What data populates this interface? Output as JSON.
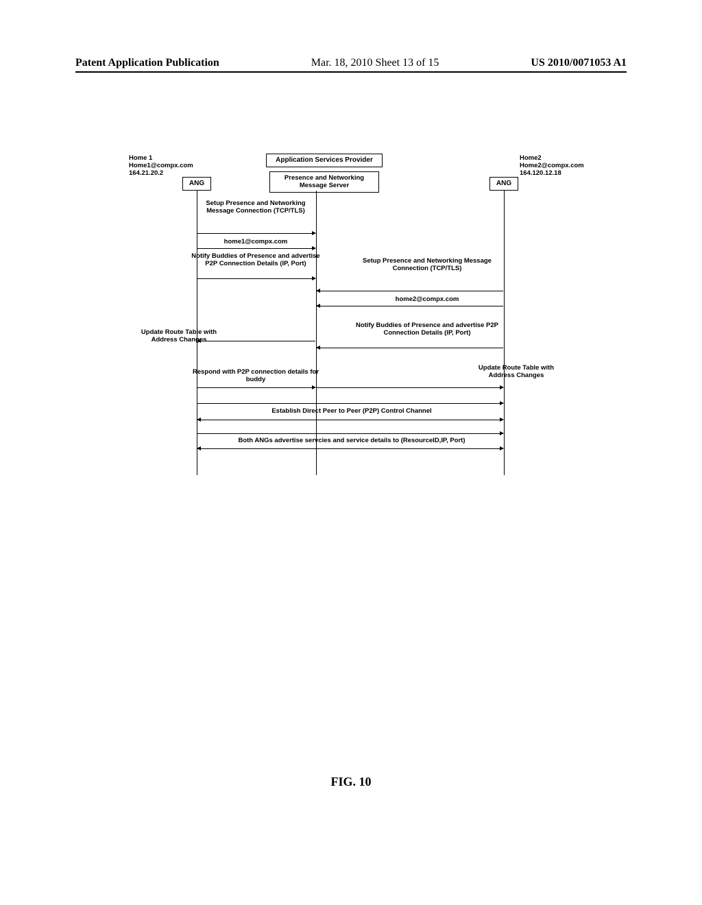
{
  "header": {
    "left": "Patent Application Publication",
    "mid": "Mar. 18, 2010  Sheet 13 of 15",
    "right": "US 2010/0071053 A1"
  },
  "home1": {
    "title": "Home 1",
    "addr": "Home1@compx.com",
    "ip": "164.21.20.2",
    "box": "ANG"
  },
  "home2": {
    "title": "Home2",
    "addr": "Home2@compx.com",
    "ip": "164.120.12.18",
    "box": "ANG"
  },
  "asp": {
    "title": "Application Services Provider",
    "sub": "Presence and Networking Message Server"
  },
  "msgs": {
    "m1": "Setup Presence and Networking Message Connection (TCP/TLS)",
    "m2": "home1@compx.com",
    "m3": "Notify Buddies of Presence and advertise P2P Connection Details (IP, Port)",
    "m4": "Setup Presence and Networking Message Connection (TCP/TLS)",
    "m5": "home2@compx.com",
    "m6": "Notify Buddies of Presence and advertise P2P Connection Details (IP, Port)",
    "m7": "Update Route Table with Address Changes",
    "m8": "Respond with P2P connection details for buddy",
    "m9": "Update Route Table with Address Changes",
    "m10": "Establish Direct Peer to Peer (P2P) Control Channel",
    "m11": "Both ANGs advertise servcies and service details to (ResourceID,IP, Port)"
  },
  "caption": "FIG. 10"
}
